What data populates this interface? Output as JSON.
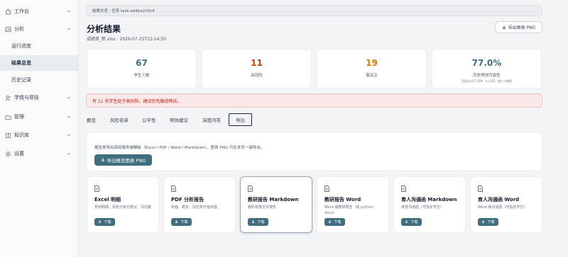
{
  "sidebar": {
    "groups": [
      {
        "label": "工作台",
        "icon": "home-icon",
        "expanded": false
      },
      {
        "label": "分析",
        "icon": "chart-icon",
        "expanded": true
      },
      {
        "label": "学情与帮扶",
        "icon": "users-icon",
        "expanded": false
      },
      {
        "label": "管理",
        "icon": "folder-icon",
        "expanded": false
      },
      {
        "label": "知识库",
        "icon": "book-icon",
        "expanded": false
      },
      {
        "label": "设置",
        "icon": "gear-icon",
        "expanded": false
      }
    ],
    "sub_items": [
      {
        "label": "运行进度",
        "active": false
      },
      {
        "label": "结果总览",
        "active": true
      },
      {
        "label": "历史记录",
        "active": false
      }
    ]
  },
  "breadcrumb": "结果总览 · 任务 task-ad4ba210c9",
  "page": {
    "title": "分析结果",
    "subline": "成绩单_新.xlsx · 2026-07-25T15:14:50",
    "export_button": "导出图表 PNG"
  },
  "stats": [
    {
      "value": "67",
      "label": "学生人数",
      "color": "#3f6f7e",
      "note": ""
    },
    {
      "value": "11",
      "label": "高风险",
      "color": "#c2410c",
      "note": ""
    },
    {
      "value": "19",
      "label": "需关注",
      "color": "#d97706",
      "note": ""
    },
    {
      "value": "77.0%",
      "label": "历史预测可靠性",
      "color": "#3f6f7e",
      "note": "[滚动]±0.5 GPA · n=335 · 留个人概率"
    }
  ],
  "alert": "有 11 名学生处于高风险，建议优先跟进帮扶。",
  "tabs": [
    {
      "label": "概览",
      "active": false
    },
    {
      "label": "风险名单",
      "active": false
    },
    {
      "label": "公平性",
      "active": false
    },
    {
      "label": "帮扶建议",
      "active": false
    },
    {
      "label": "深度问答",
      "active": false
    },
    {
      "label": "导出",
      "active": true
    }
  ],
  "export_panel": {
    "description": "报告类导出调用服务端模板（Excel / PDF / Word / Markdown），图表 PNG 可在本页一键导出。",
    "button": "导出概览图表 PNG"
  },
  "cards": [
    {
      "title": "Excel 明细",
      "description": "预测明细、风险分级与建议、评估集",
      "button": "下载"
    },
    {
      "title": "PDF 分析报告",
      "description": "封面、概览、风险表与指标图",
      "button": "下载"
    },
    {
      "title": "教研报告 Markdown",
      "description": "教研视角文字报告",
      "button": "下载"
    },
    {
      "title": "教研报告 Word",
      "description": "Word 版教研报告（需 python-docx）",
      "button": "下载"
    },
    {
      "title": "育人沟通函 Markdown",
      "description": "家校沟通函（可指定学生）",
      "button": "下载"
    },
    {
      "title": "育人沟通函 Word",
      "description": "Word 版沟通函（可指定学生）",
      "button": "下载"
    }
  ]
}
